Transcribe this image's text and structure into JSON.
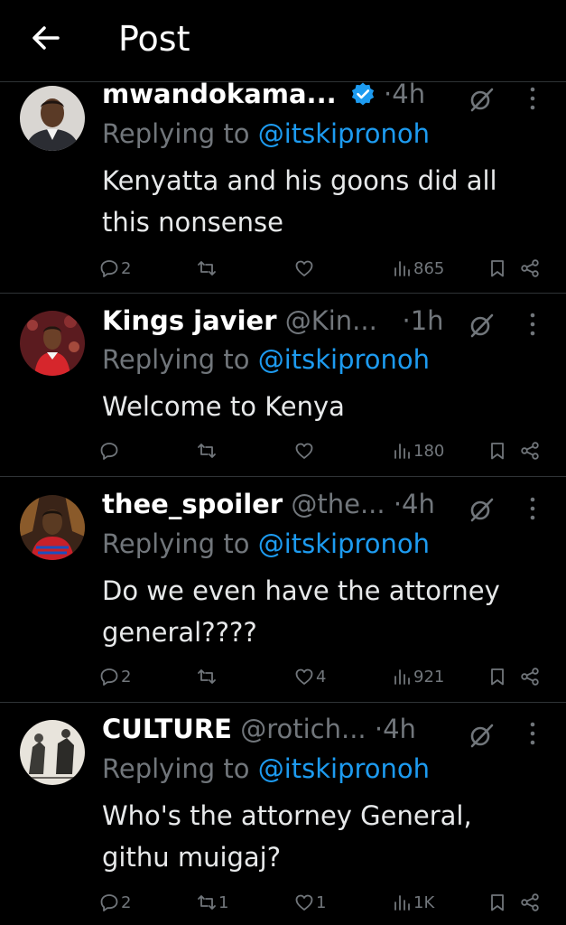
{
  "header": {
    "title": "Post",
    "back_icon": "arrow-left-icon"
  },
  "replying_prefix": "Replying to",
  "tweets": [
    {
      "name": "mwandokama...",
      "handle": "",
      "verified": true,
      "time": "4h",
      "reply_to": "@itskipronoh",
      "text": "Kenyatta and his goons did all this nonsense",
      "replies": "2",
      "reposts": "",
      "likes": "",
      "views": "865"
    },
    {
      "name": "Kings javier",
      "handle": "@Kin...",
      "verified": false,
      "time": "1h",
      "reply_to": "@itskipronoh",
      "text": "Welcome to Kenya",
      "replies": "",
      "reposts": "",
      "likes": "",
      "views": "180"
    },
    {
      "name": "thee_spoiler",
      "handle": "@the...",
      "verified": false,
      "time": "4h",
      "reply_to": "@itskipronoh",
      "text": "Do we even have the attorney general????",
      "replies": "2",
      "reposts": "",
      "likes": "4",
      "views": "921"
    },
    {
      "name": "CULTURE",
      "handle": "@rotich...",
      "verified": false,
      "time": "4h",
      "reply_to": "@itskipronoh",
      "text": "Who's the attorney General, githu muigaj?",
      "replies": "2",
      "reposts": "1",
      "likes": "1",
      "views": "1K"
    }
  ],
  "colors": {
    "background": "#000000",
    "text": "#e7e9ea",
    "muted": "#71767b",
    "link": "#1d9bf0",
    "divider": "#2f3336"
  }
}
